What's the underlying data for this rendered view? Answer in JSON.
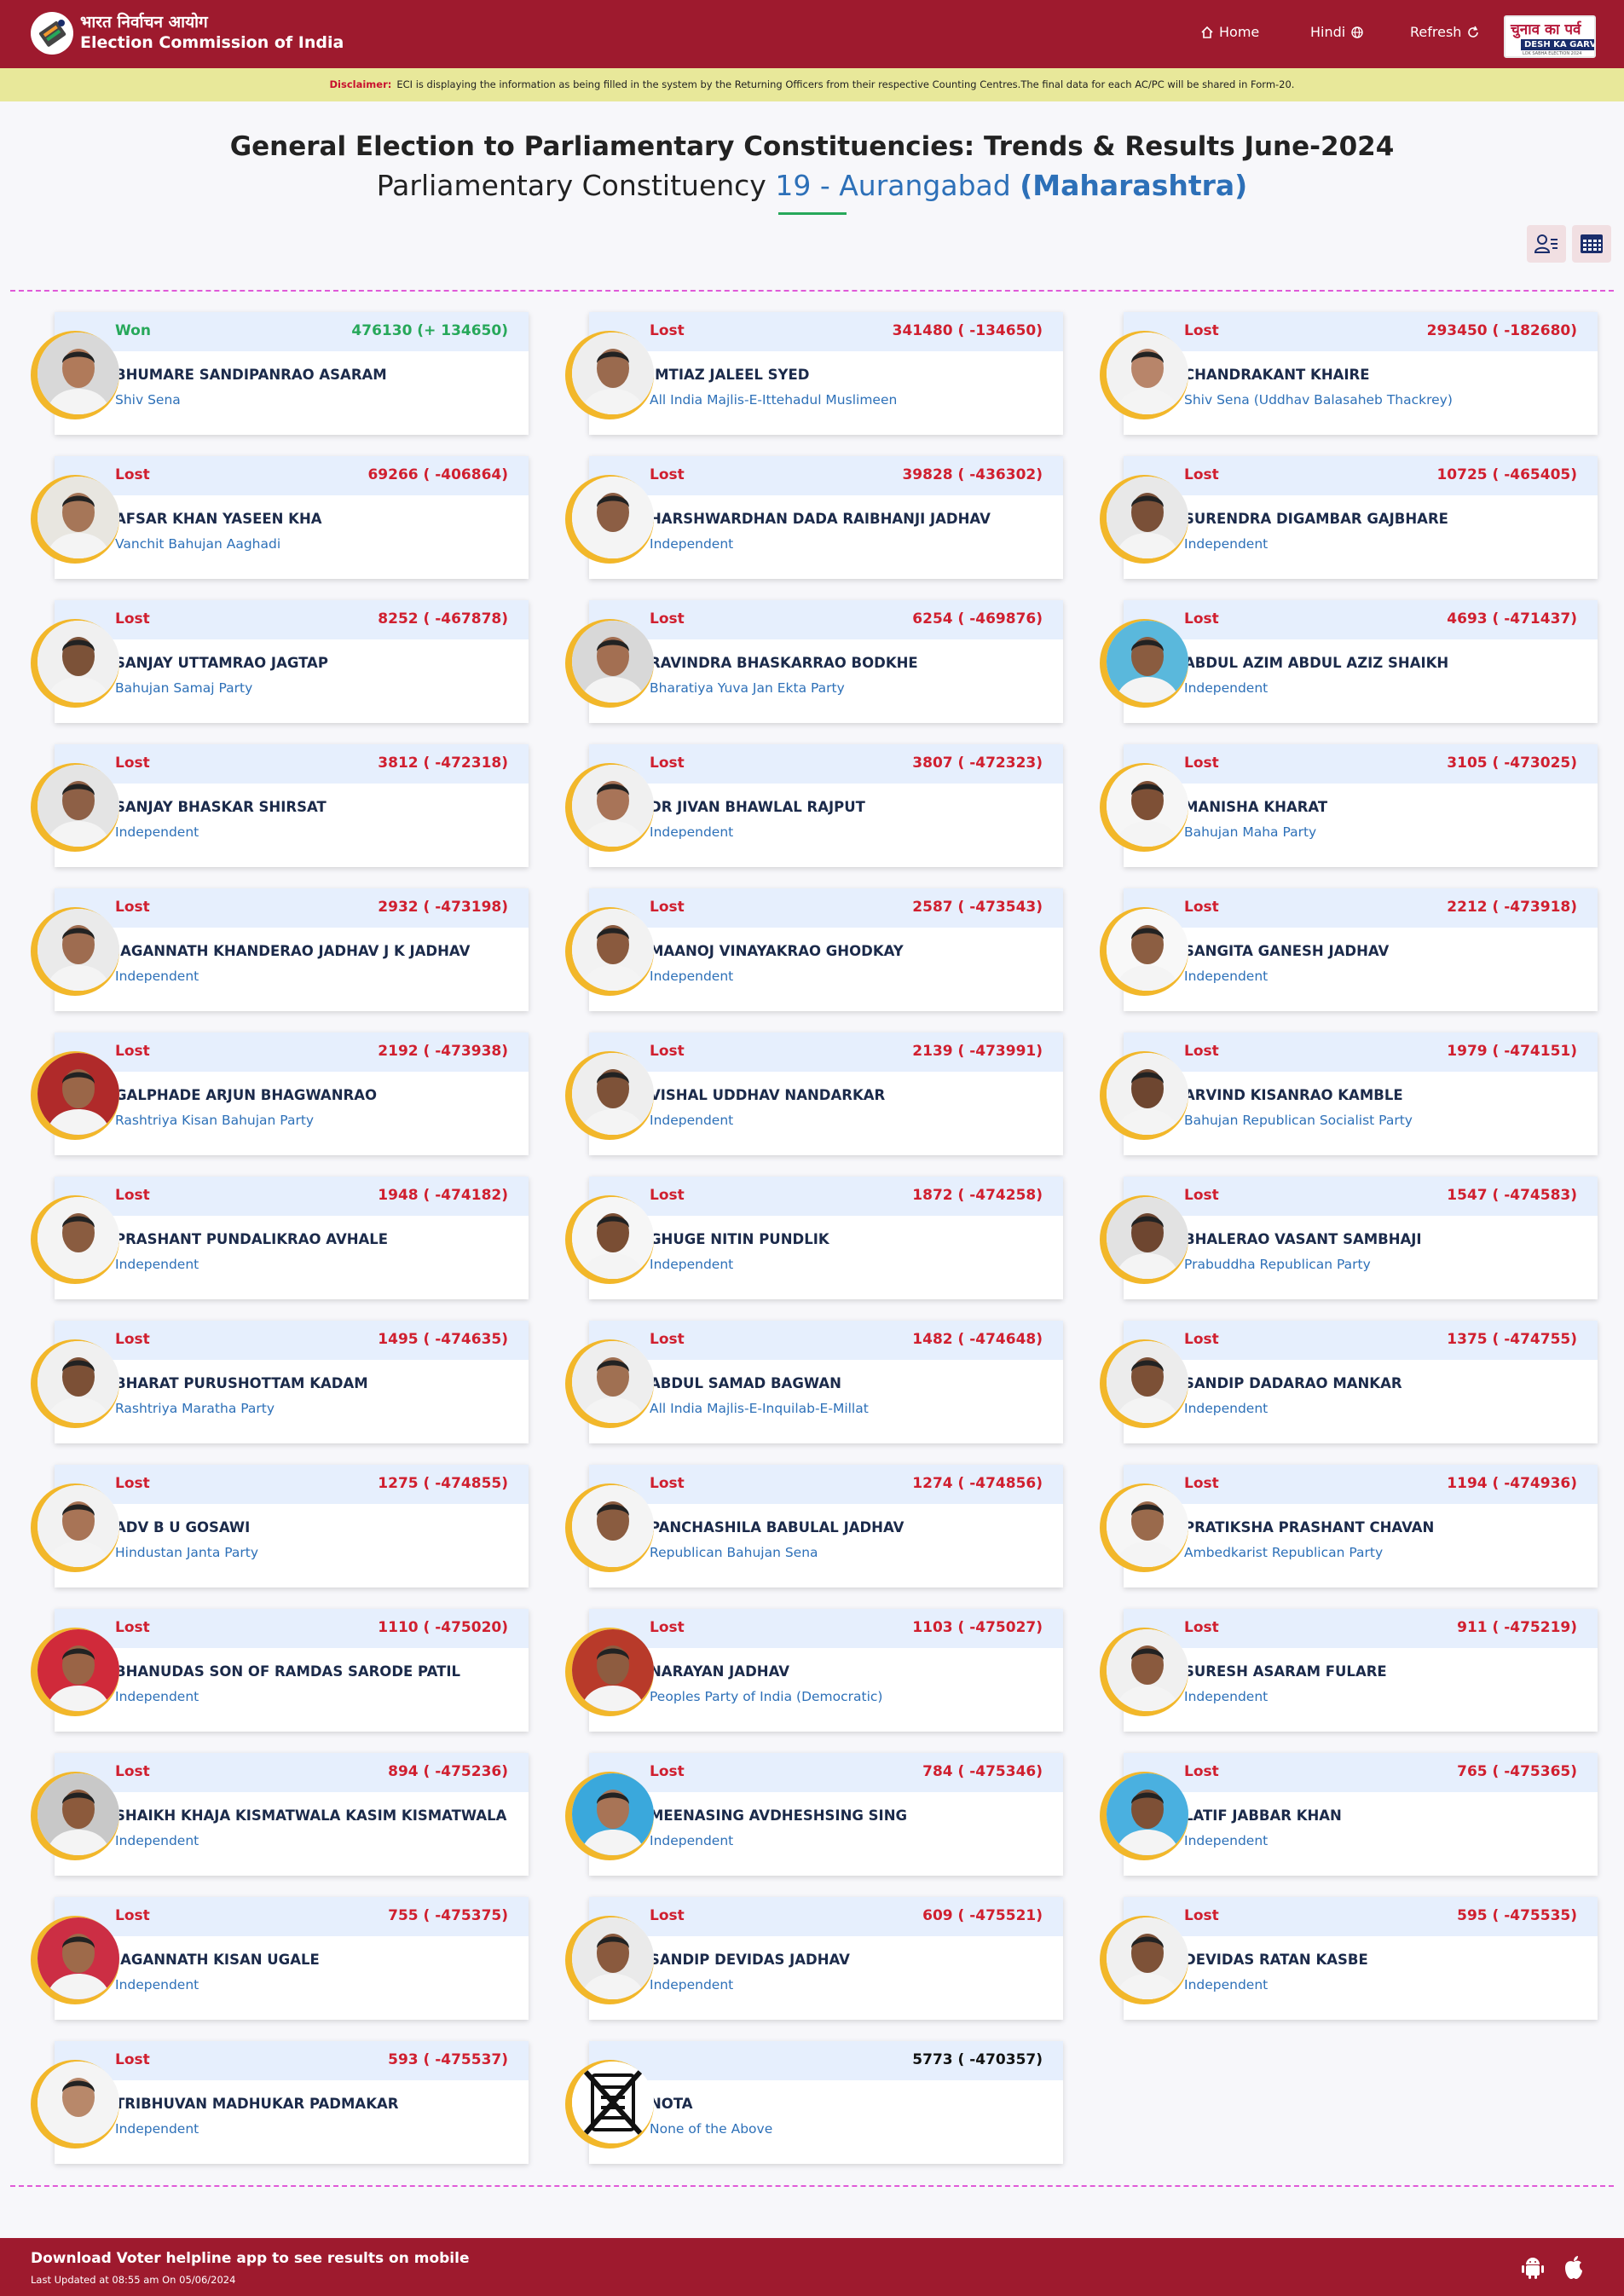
{
  "header": {
    "org_hindi": "भारत निर्वाचन आयोग",
    "org_english": "Election Commission of India",
    "nav_home": "Home",
    "nav_hindi": "Hindi",
    "nav_refresh": "Refresh",
    "campaign_hindi": "चुनाव का पर्व",
    "campaign_english": "DESH KA GARV",
    "campaign_tag": "LOK SABHA ELECTION 2024"
  },
  "disclaimer": {
    "label": "Disclaimer:",
    "text": "ECI is displaying the information as being filled in the system by the Returning Officers from their respective Counting Centres.The final data for each AC/PC will be shared in Form-20."
  },
  "page": {
    "title": "General Election to Parliamentary Constituencies: Trends & Results June-2024",
    "subtitle_prefix": "Parliamentary Constituency",
    "constituency": "19 - Aurangabad",
    "state": "(Maharashtra)"
  },
  "colors": {
    "brand": "#9e1a2e",
    "won": "#27a85a",
    "lost": "#d01f2f",
    "party": "#2d70b8",
    "ring": "#f2b72a"
  },
  "candidates": [
    {
      "status": "Won",
      "votes": "476130 (+ 134650)",
      "name": "BHUMARE SANDIPANRAO ASARAM",
      "party": "Shiv Sena",
      "photo_bg": "#d8d8d8",
      "skin": "#b07a5a"
    },
    {
      "status": "Lost",
      "votes": "341480 ( -134650)",
      "name": "IMTIAZ JALEEL SYED",
      "party": "All India Majlis-E-Ittehadul Muslimeen",
      "photo_bg": "#eeeeee",
      "skin": "#9a6a4e"
    },
    {
      "status": "Lost",
      "votes": "293450 ( -182680)",
      "name": "CHANDRAKANT KHAIRE",
      "party": "Shiv Sena (Uddhav Balasaheb Thackrey)",
      "photo_bg": "#f2f2f2",
      "skin": "#b8856a"
    },
    {
      "status": "Lost",
      "votes": "69266 ( -406864)",
      "name": "AFSAR KHAN YASEEN KHA",
      "party": "Vanchit Bahujan Aaghadi",
      "photo_bg": "#e8e6e0",
      "skin": "#a67658"
    },
    {
      "status": "Lost",
      "votes": "39828 ( -436302)",
      "name": "HARSHWARDHAN DADA RAIBHANJI JADHAV",
      "party": "Independent",
      "photo_bg": "#f4f4f4",
      "skin": "#8c5e44"
    },
    {
      "status": "Lost",
      "votes": "10725 ( -465405)",
      "name": "SURENDRA DIGAMBAR GAJBHARE",
      "party": "Independent",
      "photo_bg": "#e8e8e8",
      "skin": "#7a5038"
    },
    {
      "status": "Lost",
      "votes": "8252 ( -467878)",
      "name": "SANJAY UTTAMRAO JAGTAP",
      "party": "Bahujan Samaj Party",
      "photo_bg": "#f0f0f0",
      "skin": "#7c5238"
    },
    {
      "status": "Lost",
      "votes": "6254 ( -469876)",
      "name": "RAVINDRA BHASKARRAO BODKHE",
      "party": "Bharatiya Yuva Jan Ekta Party",
      "photo_bg": "#d8d8d8",
      "skin": "#a36f52"
    },
    {
      "status": "Lost",
      "votes": "4693 ( -471437)",
      "name": "ABDUL AZIM ABDUL AZIZ SHAIKH",
      "party": "Independent",
      "photo_bg": "#5ab8dc",
      "skin": "#8a5c40"
    },
    {
      "status": "Lost",
      "votes": "3812 ( -472318)",
      "name": "SANJAY BHASKAR SHIRSAT",
      "party": "Independent",
      "photo_bg": "#e4e4e4",
      "skin": "#8e6046"
    },
    {
      "status": "Lost",
      "votes": "3807 ( -472323)",
      "name": "DR JIVAN BHAWLAL RAJPUT",
      "party": "Independent",
      "photo_bg": "#f0f0f0",
      "skin": "#a87458"
    },
    {
      "status": "Lost",
      "votes": "3105 ( -473025)",
      "name": "MANISHA KHARAT",
      "party": "Bahujan Maha Party",
      "photo_bg": "#f6f6f6",
      "skin": "#7e5036"
    },
    {
      "status": "Lost",
      "votes": "2932 ( -473198)",
      "name": "JAGANNATH KHANDERAO JADHAV J K JADHAV",
      "party": "Independent",
      "photo_bg": "#eaeaea",
      "skin": "#9e6c50"
    },
    {
      "status": "Lost",
      "votes": "2587 ( -473543)",
      "name": "MAANOJ VINAYAKRAO GHODKAY",
      "party": "Independent",
      "photo_bg": "#f2f2f2",
      "skin": "#8a5a3e"
    },
    {
      "status": "Lost",
      "votes": "2212 ( -473918)",
      "name": "SANGITA GANESH JADHAV",
      "party": "Independent",
      "photo_bg": "#f8f8f8",
      "skin": "#8c5e42"
    },
    {
      "status": "Lost",
      "votes": "2192 ( -473938)",
      "name": "GALPHADE ARJUN BHAGWANRAO",
      "party": "Rashtriya Kisan Bahujan Party",
      "photo_bg": "#b02a2a",
      "skin": "#9a6648"
    },
    {
      "status": "Lost",
      "votes": "2139 ( -473991)",
      "name": "VISHAL UDDHAV NANDARKAR",
      "party": "Independent",
      "photo_bg": "#eeeeee",
      "skin": "#7e5238"
    },
    {
      "status": "Lost",
      "votes": "1979 ( -474151)",
      "name": "ARVIND KISANRAO KAMBLE",
      "party": "Bahujan Republican Socialist Party",
      "photo_bg": "#f2f2f2",
      "skin": "#6e4630"
    },
    {
      "status": "Lost",
      "votes": "1948 ( -474182)",
      "name": "PRASHANT PUNDALIKRAO AVHALE",
      "party": "Independent",
      "photo_bg": "#f4f4f4",
      "skin": "#8a5c40"
    },
    {
      "status": "Lost",
      "votes": "1872 ( -474258)",
      "name": "GHUGE NITIN PUNDLIK",
      "party": "Independent",
      "photo_bg": "#f6f6f6",
      "skin": "#7a4e34"
    },
    {
      "status": "Lost",
      "votes": "1547 ( -474583)",
      "name": "BHALERAO VASANT SAMBHAJI",
      "party": "Prabuddha Republican Party",
      "photo_bg": "#e2e2e2",
      "skin": "#6e4630"
    },
    {
      "status": "Lost",
      "votes": "1495 ( -474635)",
      "name": "BHARAT PURUSHOTTAM KADAM",
      "party": "Rashtriya Maratha Party",
      "photo_bg": "#f0f0f0",
      "skin": "#7c5036"
    },
    {
      "status": "Lost",
      "votes": "1482 ( -474648)",
      "name": "ABDUL SAMAD BAGWAN",
      "party": "All India Majlis-E-Inquilab-E-Millat",
      "photo_bg": "#eeeeee",
      "skin": "#a07052"
    },
    {
      "status": "Lost",
      "votes": "1375 ( -474755)",
      "name": "SANDIP DADARAO MANKAR",
      "party": "Independent",
      "photo_bg": "#ececec",
      "skin": "#7c5036"
    },
    {
      "status": "Lost",
      "votes": "1275 ( -474855)",
      "name": "ADV B U GOSAWI",
      "party": "Hindustan Janta Party",
      "photo_bg": "#f2f2f2",
      "skin": "#a87456"
    },
    {
      "status": "Lost",
      "votes": "1274 ( -474856)",
      "name": "PANCHASHILA BABULAL JADHAV",
      "party": "Republican Bahujan Sena",
      "photo_bg": "#f4f4f4",
      "skin": "#8a5c40"
    },
    {
      "status": "Lost",
      "votes": "1194 ( -474936)",
      "name": "PRATIKSHA PRASHANT CHAVAN",
      "party": "Ambedkarist Republican Party",
      "photo_bg": "#f6f6f6",
      "skin": "#9a6a4c"
    },
    {
      "status": "Lost",
      "votes": "1110 ( -475020)",
      "name": "BHANUDAS SON OF RAMDAS SARODE PATIL",
      "party": "Independent",
      "photo_bg": "#d02a3a",
      "skin": "#9a6446"
    },
    {
      "status": "Lost",
      "votes": "1103 ( -475027)",
      "name": "NARAYAN JADHAV",
      "party": "Peoples Party of India (Democratic)",
      "photo_bg": "#b83a2a",
      "skin": "#8e5c40"
    },
    {
      "status": "Lost",
      "votes": "911 ( -475219)",
      "name": "SURESH ASARAM FULARE",
      "party": "Independent",
      "photo_bg": "#f0f0f0",
      "skin": "#8a5a3e"
    },
    {
      "status": "Lost",
      "votes": "894 ( -475236)",
      "name": "SHAIKH KHAJA KISMATWALA KASIM KISMATWALA",
      "party": "Independent",
      "photo_bg": "#c8c8c8",
      "skin": "#8c5a3c"
    },
    {
      "status": "Lost",
      "votes": "784 ( -475346)",
      "name": "MEENASING AVDHESHSING SING",
      "party": "Independent",
      "photo_bg": "#3aa8dc",
      "skin": "#a87456"
    },
    {
      "status": "Lost",
      "votes": "765 ( -475365)",
      "name": "LATIF JABBAR KHAN",
      "party": "Independent",
      "photo_bg": "#4ab0e0",
      "skin": "#7e5036"
    },
    {
      "status": "Lost",
      "votes": "755 ( -475375)",
      "name": "JAGANNATH KISAN UGALE",
      "party": "Independent",
      "photo_bg": "#cc2e44",
      "skin": "#9e6a4a"
    },
    {
      "status": "Lost",
      "votes": "609 ( -475521)",
      "name": "SANDIP DEVIDAS JADHAV",
      "party": "Independent",
      "photo_bg": "#eaeaea",
      "skin": "#8a5a3e"
    },
    {
      "status": "Lost",
      "votes": "595 ( -475535)",
      "name": "DEVIDAS RATAN KASBE",
      "party": "Independent",
      "photo_bg": "#f0f0f0",
      "skin": "#7e5238"
    },
    {
      "status": "Lost",
      "votes": "593 ( -475537)",
      "name": "TRIBHUVAN MADHUKAR PADMAKAR",
      "party": "Independent",
      "photo_bg": "#f4f4f4",
      "skin": "#b8886a"
    },
    {
      "status": "",
      "votes": "5773 ( -470357)",
      "name": "NOTA",
      "party": "None of the Above",
      "photo_bg": "#ffffff",
      "skin": "nota"
    }
  ],
  "footer": {
    "line1": "Download Voter helpline app to see results on mobile",
    "line2": "Last Updated at 08:55 am On 05/06/2024"
  }
}
